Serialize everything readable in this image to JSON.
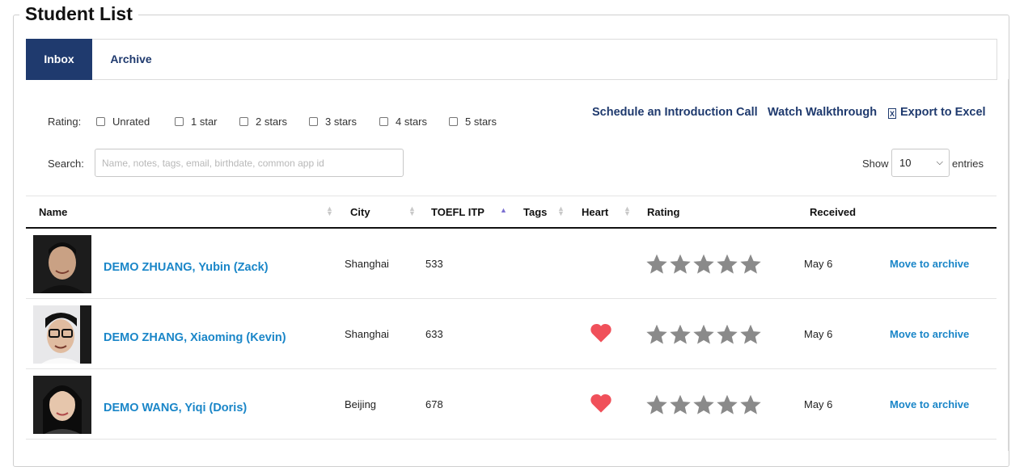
{
  "title": "Student List",
  "tabs": [
    {
      "label": "Inbox"
    },
    {
      "label": "Archive"
    }
  ],
  "filters": {
    "rating_label": "Rating:",
    "options": [
      "Unrated",
      "1 star",
      "2 stars",
      "3 stars",
      "4 stars",
      "5 stars"
    ]
  },
  "actions": {
    "schedule": "Schedule an Introduction Call",
    "walkthrough": "Watch Walkthrough",
    "export": "Export to Excel"
  },
  "search": {
    "label": "Search:",
    "placeholder": "Name, notes, tags, email, birthdate, common app id",
    "value": ""
  },
  "entries": {
    "show_label": "Show",
    "value": "10",
    "suffix": "entries"
  },
  "table": {
    "columns": [
      "Name",
      "City",
      "TOEFL ITP",
      "Tags",
      "Heart",
      "Rating",
      "Received"
    ],
    "sorted_column": "TOEFL ITP",
    "sort_direction": "ascending",
    "rows": [
      {
        "name": "DEMO ZHUANG, Yubin (Zack)",
        "city": "Shanghai",
        "toefl": "533",
        "tags": "",
        "heart": false,
        "rating": 0,
        "received": "May 6",
        "action": "Move to archive"
      },
      {
        "name": "DEMO ZHANG, Xiaoming (Kevin)",
        "city": "Shanghai",
        "toefl": "633",
        "tags": "",
        "heart": true,
        "rating": 0,
        "received": "May 6",
        "action": "Move to archive"
      },
      {
        "name": "DEMO WANG, Yiqi (Doris)",
        "city": "Beijing",
        "toefl": "678",
        "tags": "",
        "heart": true,
        "rating": 0,
        "received": "May 6",
        "action": "Move to archive"
      }
    ]
  },
  "icons": {
    "excel": "excel-file-icon",
    "heart": "heart-icon",
    "star": "star-icon",
    "sort": "sort-icon",
    "dropdown": "chevron-down-icon"
  },
  "colors": {
    "primary": "#1f3a6e",
    "link": "#1a86c8",
    "heart": "#f0505a",
    "star_empty": "#8a8a8a",
    "sort_active": "#7b6fd1"
  }
}
